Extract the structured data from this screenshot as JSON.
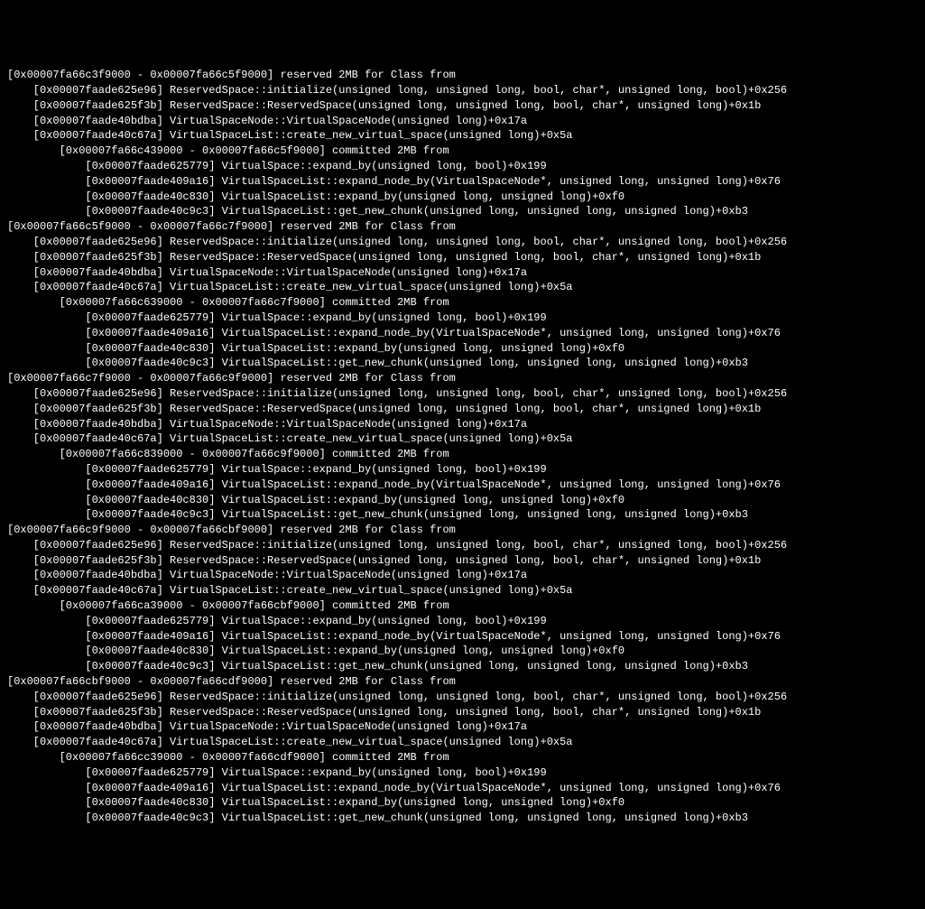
{
  "reserved_trace": [
    {
      "addr": "[0x00007faade625e96]",
      "text": "ReservedSpace::initialize(unsigned long, unsigned long, bool, char*, unsigned long, bool)+0x256"
    },
    {
      "addr": "[0x00007faade625f3b]",
      "text": "ReservedSpace::ReservedSpace(unsigned long, unsigned long, bool, char*, unsigned long)+0x1b"
    },
    {
      "addr": "[0x00007faade40bdba]",
      "text": "VirtualSpaceNode::VirtualSpaceNode(unsigned long)+0x17a"
    },
    {
      "addr": "[0x00007faade40c67a]",
      "text": "VirtualSpaceList::create_new_virtual_space(unsigned long)+0x5a"
    }
  ],
  "committed_trace": [
    {
      "addr": "[0x00007faade625779]",
      "text": "VirtualSpace::expand_by(unsigned long, bool)+0x199"
    },
    {
      "addr": "[0x00007faade409a16]",
      "text": "VirtualSpaceList::expand_node_by(VirtualSpaceNode*, unsigned long, unsigned long)+0x76"
    },
    {
      "addr": "[0x00007faade40c830]",
      "text": "VirtualSpaceList::expand_by(unsigned long, unsigned long)+0xf0"
    },
    {
      "addr": "[0x00007faade40c9c3]",
      "text": "VirtualSpaceList::get_new_chunk(unsigned long, unsigned long, unsigned long)+0xb3"
    }
  ],
  "blocks": [
    {
      "reserved_header": "[0x00007fa66c3f9000 - 0x00007fa66c5f9000] reserved 2MB for Class from",
      "committed_header": "[0x00007fa66c439000 - 0x00007fa66c5f9000] committed 2MB from"
    },
    {
      "reserved_header": "[0x00007fa66c5f9000 - 0x00007fa66c7f9000] reserved 2MB for Class from",
      "committed_header": "[0x00007fa66c639000 - 0x00007fa66c7f9000] committed 2MB from"
    },
    {
      "reserved_header": "[0x00007fa66c7f9000 - 0x00007fa66c9f9000] reserved 2MB for Class from",
      "committed_header": "[0x00007fa66c839000 - 0x00007fa66c9f9000] committed 2MB from"
    },
    {
      "reserved_header": "[0x00007fa66c9f9000 - 0x00007fa66cbf9000] reserved 2MB for Class from",
      "committed_header": "[0x00007fa66ca39000 - 0x00007fa66cbf9000] committed 2MB from"
    },
    {
      "reserved_header": "[0x00007fa66cbf9000 - 0x00007fa66cdf9000] reserved 2MB for Class from",
      "committed_header": "[0x00007fa66cc39000 - 0x00007fa66cdf9000] committed 2MB from"
    }
  ]
}
